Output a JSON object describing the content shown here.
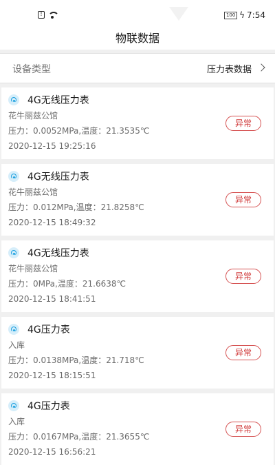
{
  "status_bar": {
    "battery": "100",
    "time": "7:54"
  },
  "header": {
    "title": "物联数据"
  },
  "filter": {
    "label": "设备类型",
    "value": "压力表数据"
  },
  "records": [
    {
      "name": "4G无线压力表",
      "location": "花牛丽兹公馆",
      "reading": "压力：0.0052MPa,温度：21.3535℃",
      "time": "2020-12-15 19:25:16",
      "status": "异常"
    },
    {
      "name": "4G无线压力表",
      "location": "花牛丽兹公馆",
      "reading": "压力：0.012MPa,温度：21.8258℃",
      "time": "2020-12-15 18:49:32",
      "status": "异常"
    },
    {
      "name": "4G无线压力表",
      "location": "花牛丽兹公馆",
      "reading": "压力：0MPa,温度：21.6638℃",
      "time": "2020-12-15 18:41:51",
      "status": "异常"
    },
    {
      "name": "4G压力表",
      "location": "入库",
      "reading": "压力：0.0138MPa,温度：21.718℃",
      "time": "2020-12-15 18:15:51",
      "status": "异常"
    },
    {
      "name": "4G压力表",
      "location": "入库",
      "reading": "压力：0.0167MPa,温度：21.3655℃",
      "time": "2020-12-15 16:56:21",
      "status": "异常"
    }
  ],
  "colors": {
    "status_accent": "#d03b3b",
    "icon_accent": "#1aa0e0"
  }
}
